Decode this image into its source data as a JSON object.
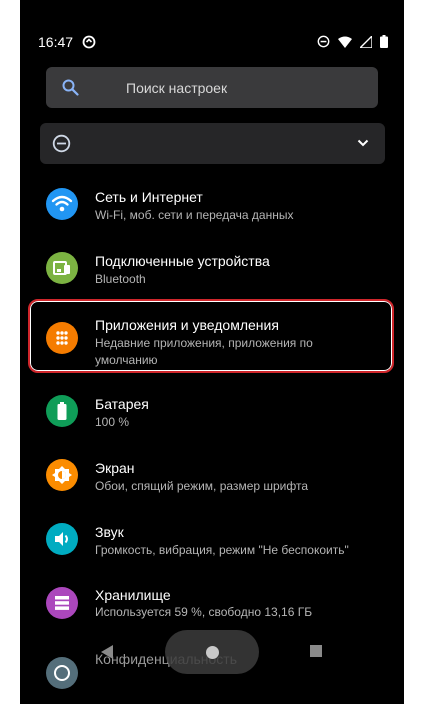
{
  "status": {
    "time": "16:47"
  },
  "search": {
    "placeholder": "Поиск настроек"
  },
  "items": [
    {
      "title": "Сеть и Интернет",
      "subtitle": "Wi-Fi, моб. сети и передача данных",
      "icon": "wifi-icon",
      "color": "#2196f3"
    },
    {
      "title": "Подключенные устройства",
      "subtitle": "Bluetooth",
      "icon": "devices-icon",
      "color": "#7cb342"
    },
    {
      "title": "Приложения и уведомления",
      "subtitle": "Недавние приложения, приложения по умолчанию",
      "icon": "apps-icon",
      "color": "#f57c00"
    },
    {
      "title": "Батарея",
      "subtitle": "100 %",
      "icon": "battery-icon",
      "color": "#0f9d58"
    },
    {
      "title": "Экран",
      "subtitle": "Обои, спящий режим, размер шрифта",
      "icon": "brightness-icon",
      "color": "#fb8c00"
    },
    {
      "title": "Звук",
      "subtitle": "Громкость, вибрация, режим \"Не беспокоить\"",
      "icon": "volume-icon",
      "color": "#00acc1"
    },
    {
      "title": "Хранилище",
      "subtitle": "Используется 59 %, свободно 13,16 ГБ",
      "icon": "storage-icon",
      "color": "#ab47bc"
    },
    {
      "title": "Конфиденциальность",
      "icon": "privacy-icon",
      "color": "#546e7a"
    }
  ]
}
